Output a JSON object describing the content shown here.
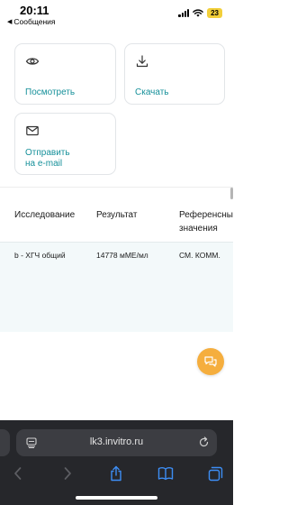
{
  "status_bar": {
    "time": "20:11",
    "back_app": "Сообщения",
    "battery": "23"
  },
  "actions": {
    "view": {
      "label": "Посмотреть",
      "icon": "eye-icon"
    },
    "download": {
      "label": "Скачать",
      "icon": "download-icon"
    },
    "email": {
      "label_line1": "Отправить",
      "label_line2": "на e-mail",
      "icon": "mail-icon"
    }
  },
  "table": {
    "headers": {
      "study": "Исследование",
      "result": "Результат",
      "reference_line1": "Референсны",
      "reference_line2": "значения"
    },
    "rows": [
      {
        "study": "b - ХГЧ общий",
        "result": "14778 мМЕ/мл",
        "reference": "СМ. КОММ."
      }
    ]
  },
  "browser": {
    "url": "lk3.invitro.ru"
  },
  "colors": {
    "accent": "#16909a",
    "chat_button": "#f5ae3e",
    "row_background": "#f3f9fa",
    "safari_bar": "#26272b",
    "battery": "#f2cf3a"
  }
}
